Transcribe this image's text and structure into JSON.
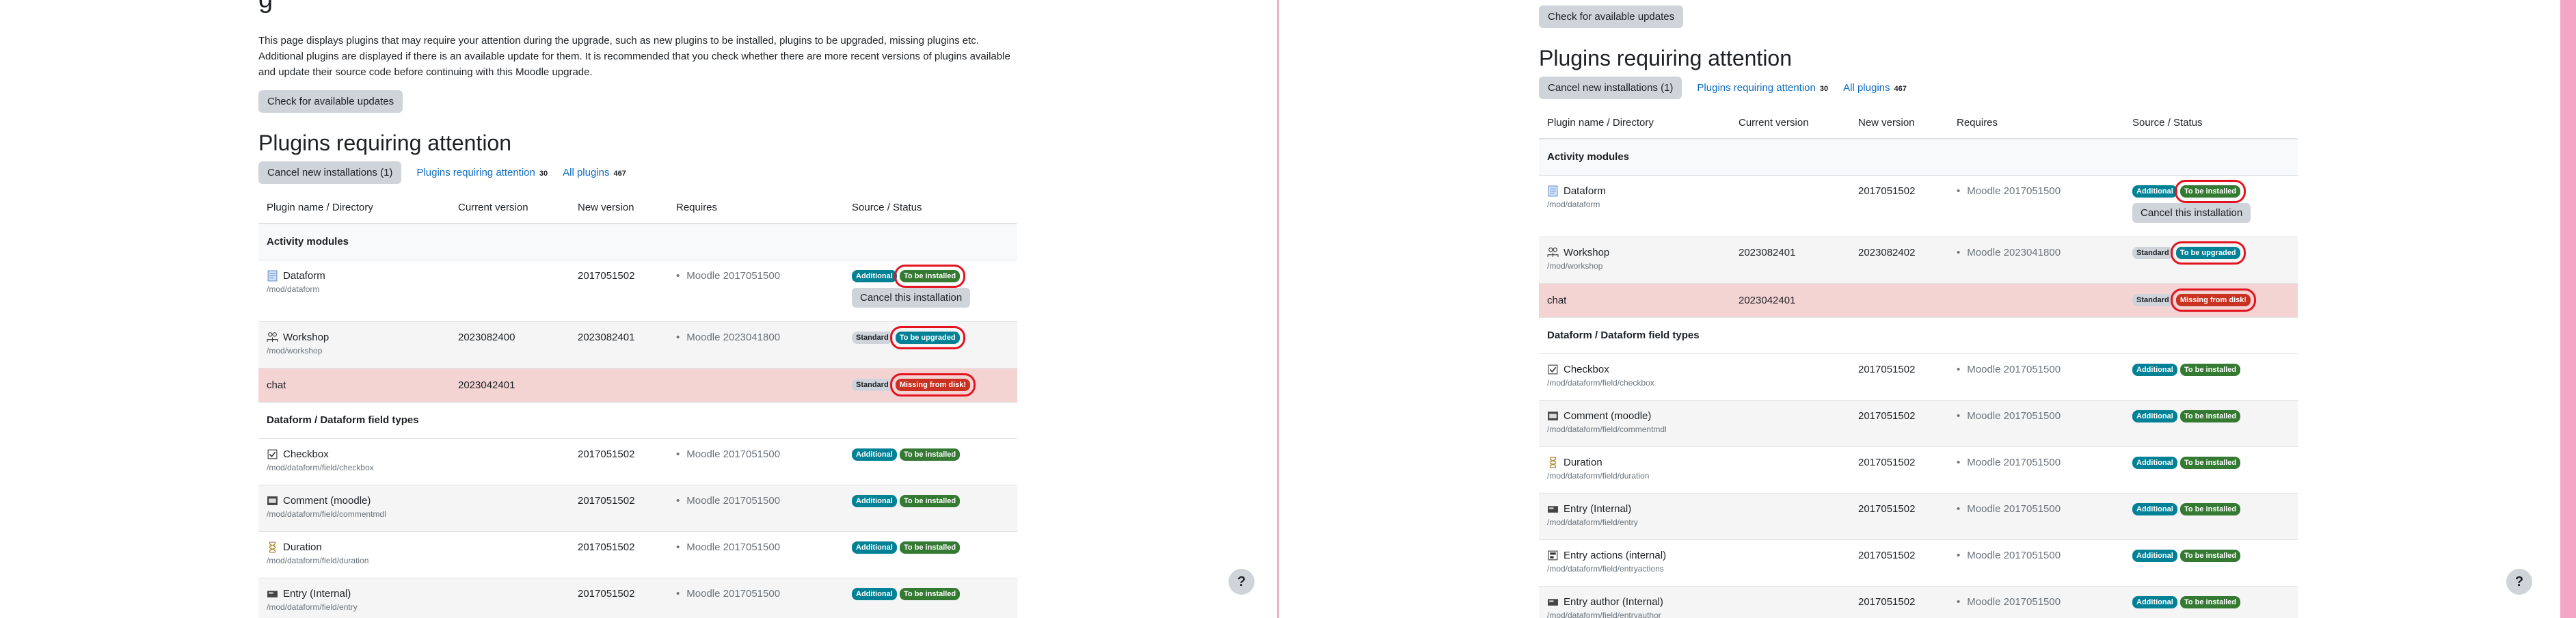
{
  "left": {
    "title_cut": "g",
    "intro": "This page displays plugins that may require your attention during the upgrade, such as new plugins to be installed, plugins to be upgraded, missing plugins etc. Additional plugins are displayed if there is an available update for them. It is recommended that you check whether there are more recent versions of plugins available and update their source code before continuing with this Moodle upgrade.",
    "check_updates": "Check for available updates",
    "heading": "Plugins requiring attention",
    "tabs": {
      "cancel_new": "Cancel new installations (1)",
      "requiring": "Plugins requiring attention",
      "requiring_count": "30",
      "all": "All plugins",
      "all_count": "467"
    },
    "columns": [
      "Plugin name / Directory",
      "Current version",
      "New version",
      "Requires",
      "Source / Status"
    ],
    "group1": "Activity modules",
    "group2": "Dataform / Dataform field types",
    "rows": [
      {
        "name": "Dataform",
        "dir": "/mod/dataform",
        "current": "",
        "new": "2017051502",
        "requires": "Moodle 2017051500",
        "source": "Additional",
        "status": "To be installed",
        "cancel": "Cancel this installation"
      },
      {
        "name": "Workshop",
        "dir": "/mod/workshop",
        "current": "2023082400",
        "new": "2023082401",
        "requires": "Moodle 2023041800",
        "source": "Standard",
        "status": "To be upgraded"
      },
      {
        "name": "chat",
        "current": "2023042401",
        "source": "Standard",
        "status": "Missing from disk!"
      },
      {
        "name": "Checkbox",
        "dir": "/mod/dataform/field/checkbox",
        "new": "2017051502",
        "requires": "Moodle 2017051500",
        "source": "Additional",
        "status": "To be installed"
      },
      {
        "name": "Comment (moodle)",
        "dir": "/mod/dataform/field/commentmdl",
        "new": "2017051502",
        "requires": "Moodle 2017051500",
        "source": "Additional",
        "status": "To be installed"
      },
      {
        "name": "Duration",
        "dir": "/mod/dataform/field/duration",
        "new": "2017051502",
        "requires": "Moodle 2017051500",
        "source": "Additional",
        "status": "To be installed"
      },
      {
        "name": "Entry (Internal)",
        "dir": "/mod/dataform/field/entry",
        "new": "2017051502",
        "requires": "Moodle 2017051500",
        "source": "Additional",
        "status": "To be installed"
      }
    ]
  },
  "right": {
    "check_updates": "Check for available updates",
    "heading": "Plugins requiring attention",
    "tabs": {
      "cancel_new": "Cancel new installations (1)",
      "requiring": "Plugins requiring attention",
      "requiring_count": "30",
      "all": "All plugins",
      "all_count": "467"
    },
    "columns": [
      "Plugin name / Directory",
      "Current version",
      "New version",
      "Requires",
      "Source / Status"
    ],
    "group1": "Activity modules",
    "group2": "Dataform / Dataform field types",
    "rows": [
      {
        "name": "Dataform",
        "dir": "/mod/dataform",
        "new": "2017051502",
        "requires": "Moodle 2017051500",
        "source": "Additional",
        "status": "To be installed",
        "cancel": "Cancel this installation"
      },
      {
        "name": "Workshop",
        "dir": "/mod/workshop",
        "current": "2023082401",
        "new": "2023082402",
        "requires": "Moodle 2023041800",
        "source": "Standard",
        "status": "To be upgraded"
      },
      {
        "name": "chat",
        "current": "2023042401",
        "source": "Standard",
        "status": "Missing from disk!"
      },
      {
        "name": "Checkbox",
        "dir": "/mod/dataform/field/checkbox",
        "new": "2017051502",
        "requires": "Moodle 2017051500",
        "source": "Additional",
        "status": "To be installed"
      },
      {
        "name": "Comment (moodle)",
        "dir": "/mod/dataform/field/commentmdl",
        "new": "2017051502",
        "requires": "Moodle 2017051500",
        "source": "Additional",
        "status": "To be installed"
      },
      {
        "name": "Duration",
        "dir": "/mod/dataform/field/duration",
        "new": "2017051502",
        "requires": "Moodle 2017051500",
        "source": "Additional",
        "status": "To be installed"
      },
      {
        "name": "Entry (Internal)",
        "dir": "/mod/dataform/field/entry",
        "new": "2017051502",
        "requires": "Moodle 2017051500",
        "source": "Additional",
        "status": "To be installed"
      },
      {
        "name": "Entry actions (internal)",
        "dir": "/mod/dataform/field/entryactions",
        "new": "2017051502",
        "requires": "Moodle 2017051500",
        "source": "Additional",
        "status": "To be installed"
      },
      {
        "name": "Entry author (Internal)",
        "dir": "/mod/dataform/field/entryauthor",
        "new": "2017051502",
        "requires": "Moodle 2017051500",
        "source": "Additional",
        "status": "To be installed"
      }
    ]
  },
  "help_label": "?",
  "icons": [
    "dataform-icon",
    "workshop-icon",
    "checkbox-icon",
    "comment-icon",
    "duration-icon",
    "entry-icon",
    "entry-actions-icon",
    "entry-author-icon"
  ]
}
